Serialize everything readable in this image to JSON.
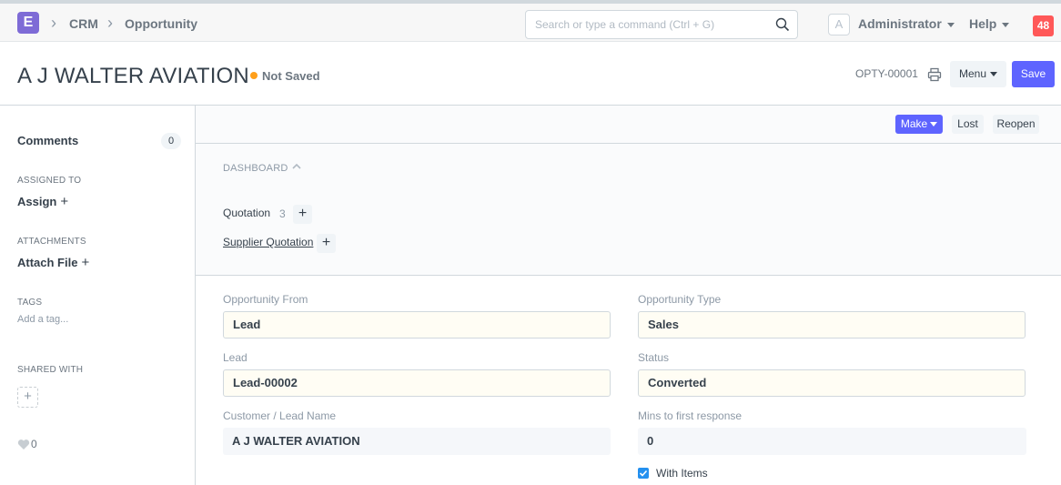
{
  "navbar": {
    "logo_letter": "E",
    "breadcrumbs": [
      "CRM",
      "Opportunity"
    ],
    "search_placeholder": "Search or type a command (Ctrl + G)",
    "avatar_letter": "A",
    "user": "Administrator",
    "help": "Help",
    "notifications": "48"
  },
  "page": {
    "title": "A J WALTER AVIATION",
    "status": "Not Saved",
    "docname": "OPTY-00001",
    "menu_label": "Menu",
    "save_label": "Save"
  },
  "sidebar": {
    "comments_label": "Comments",
    "comments_count": "0",
    "assigned_to_label": "ASSIGNED TO",
    "assign_label": "Assign",
    "attachments_label": "ATTACHMENTS",
    "attach_label": "Attach File",
    "tags_label": "TAGS",
    "add_tag": "Add a tag...",
    "shared_with_label": "SHARED WITH",
    "likes": "0"
  },
  "actions": {
    "make": "Make",
    "lost": "Lost",
    "reopen": "Reopen"
  },
  "dashboard": {
    "title": "DASHBOARD",
    "links": [
      {
        "label": "Quotation",
        "count": "3"
      },
      {
        "label": "Supplier Quotation"
      }
    ]
  },
  "form": {
    "opportunity_from": {
      "label": "Opportunity From",
      "value": "Lead"
    },
    "opportunity_type": {
      "label": "Opportunity Type",
      "value": "Sales"
    },
    "lead": {
      "label": "Lead",
      "value": "Lead-00002"
    },
    "status": {
      "label": "Status",
      "value": "Converted"
    },
    "customer_lead_name": {
      "label": "Customer / Lead Name",
      "value": "A J WALTER AVIATION"
    },
    "mins_to_first_response": {
      "label": "Mins to first response",
      "value": "0"
    },
    "with_items": {
      "label": "With Items",
      "checked": true
    }
  },
  "colors": {
    "primary": "#5e64ff",
    "logo": "#7e6bd6",
    "not_saved_dot": "#ff9f1a",
    "notification": "#ff5858"
  }
}
